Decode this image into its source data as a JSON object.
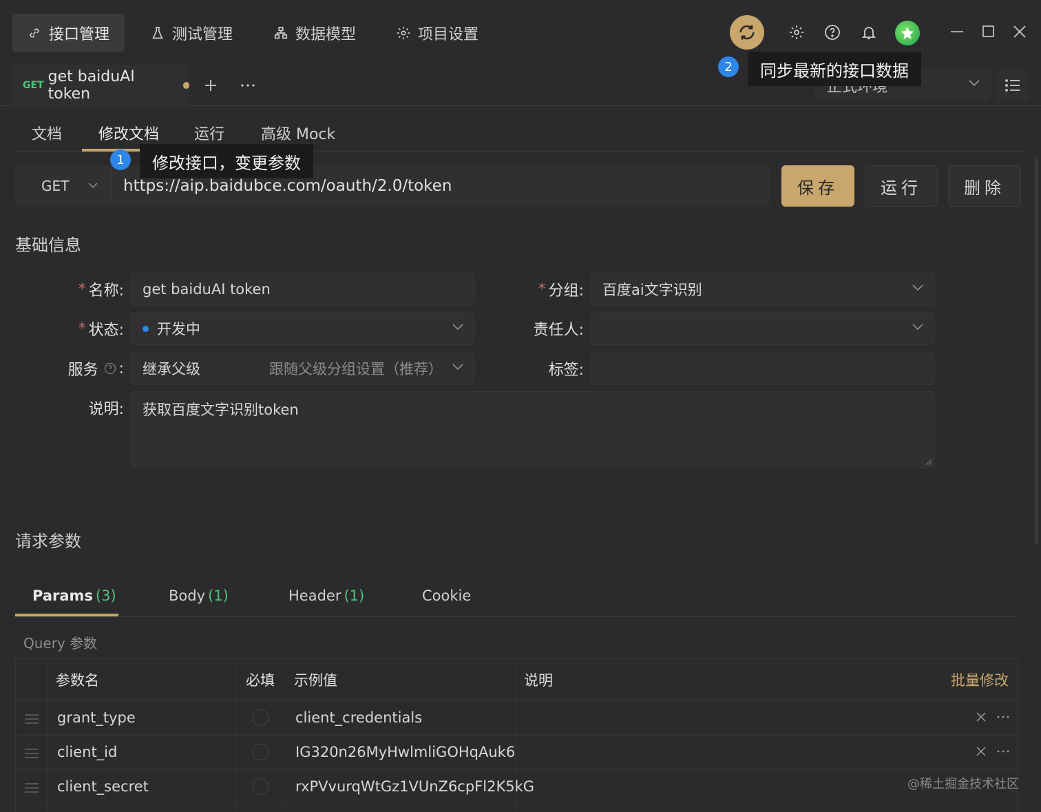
{
  "nav": {
    "tabs": [
      {
        "label": "接口管理",
        "icon": "link-icon"
      },
      {
        "label": "测试管理",
        "icon": "flask-icon"
      },
      {
        "label": "数据模型",
        "icon": "hierarchy-icon"
      },
      {
        "label": "项目设置",
        "icon": "gear-icon"
      }
    ]
  },
  "tooltips": {
    "sync": {
      "badge": "2",
      "text": "同步最新的接口数据"
    },
    "edit": {
      "badge": "1",
      "text": "修改接口，变更参数"
    }
  },
  "doc_tab": {
    "method": "GET",
    "title": "get baiduAI token"
  },
  "env": {
    "label": "正式环境"
  },
  "subtabs": [
    "文档",
    "修改文档",
    "运行",
    "高级 Mock"
  ],
  "request": {
    "method": "GET",
    "url": "https://aip.baidubce.com/oauth/2.0/token",
    "save_label": "保存",
    "run_label": "运行",
    "delete_label": "删除"
  },
  "basic_info": {
    "title": "基础信息",
    "name_label": "名称:",
    "name_value": "get baiduAI token",
    "group_label": "分组:",
    "group_value": "百度ai文字识别",
    "status_label": "状态:",
    "status_value": "开发中",
    "owner_label": "责任人:",
    "owner_value": "",
    "service_label": "服务",
    "service_colon": ":",
    "service_value": "继承父级",
    "service_hint": "跟随父级分组设置（推荐）",
    "tags_label": "标签:",
    "tags_value": "",
    "desc_label": "说明:",
    "desc_value": "获取百度文字识别token"
  },
  "request_params": {
    "title": "请求参数",
    "tabs": [
      {
        "label": "Params",
        "count": "(3)"
      },
      {
        "label": "Body",
        "count": "(1)"
      },
      {
        "label": "Header",
        "count": "(1)"
      },
      {
        "label": "Cookie",
        "count": ""
      }
    ],
    "query_label": "Query 参数",
    "columns": {
      "name": "参数名",
      "required": "必填",
      "example": "示例值",
      "desc": "说明",
      "bulk_edit": "批量修改"
    },
    "rows": [
      {
        "name": "grant_type",
        "example": "client_credentials",
        "desc": ""
      },
      {
        "name": "client_id",
        "example": "IG320n26MyHwlmliGOHqAuk6",
        "desc": ""
      },
      {
        "name": "client_secret",
        "example": "rxPVvurqWtGz1VUnZ6cpFl2K5kG",
        "desc": ""
      }
    ]
  },
  "watermark": "@稀土掘金技术社区",
  "colors": {
    "accent": "#c9a66b",
    "method_get": "#4fc37a",
    "badge": "#2e86e6",
    "background": "#2b2b2d"
  }
}
